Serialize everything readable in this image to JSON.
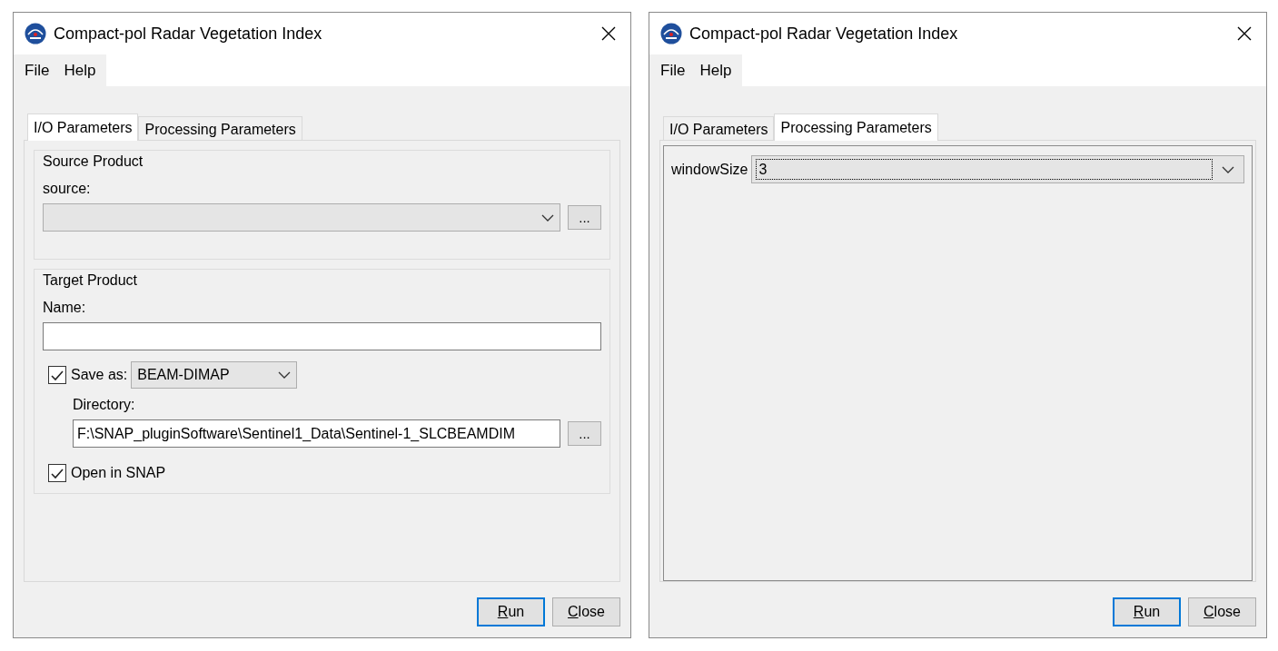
{
  "windows": [
    {
      "title": "Compact-pol Radar Vegetation Index",
      "menu": [
        "File",
        "Help"
      ],
      "tabs": [
        {
          "label": "I/O Parameters",
          "selected": true
        },
        {
          "label": "Processing Parameters",
          "selected": false
        }
      ],
      "panel": {
        "kind": "io",
        "source_product": {
          "title": "Source Product",
          "label": "source:",
          "browse": "..."
        },
        "target_product": {
          "title": "Target Product",
          "name_label": "Name:",
          "save_as": {
            "label": "Save as:",
            "checked": true,
            "format": "BEAM-DIMAP"
          },
          "directory_label": "Directory:",
          "directory": "F:\\SNAP_pluginSoftware\\Sentinel1_Data\\Sentinel-1_SLCBEAMDIM",
          "browse": "...",
          "open_in_snap": {
            "label": "Open in SNAP",
            "checked": true
          }
        }
      },
      "buttons": [
        {
          "label": "Run",
          "default": true
        },
        {
          "label": "Close",
          "default": false
        }
      ]
    },
    {
      "title": "Compact-pol Radar Vegetation Index",
      "menu": [
        "File",
        "Help"
      ],
      "tabs": [
        {
          "label": "I/O Parameters",
          "selected": false
        },
        {
          "label": "Processing Parameters",
          "selected": true
        }
      ],
      "panel": {
        "kind": "processing",
        "parameters": [
          {
            "label": "windowSize",
            "value": "3",
            "focused": true
          }
        ]
      },
      "buttons": [
        {
          "label": "Run",
          "default": true
        },
        {
          "label": "Close",
          "default": false
        }
      ]
    }
  ]
}
